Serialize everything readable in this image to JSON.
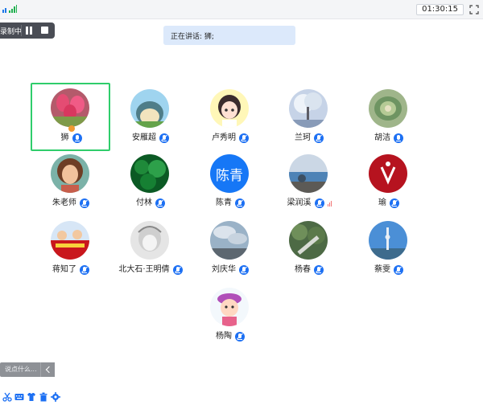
{
  "topbar": {
    "timer": "01:30:15",
    "icons": [
      "network-icon",
      "signal-icon",
      "fullscreen-icon"
    ]
  },
  "recording": {
    "label": "录制中",
    "pause": "pause-icon",
    "stop": "stop-icon"
  },
  "speaking": {
    "text": "正在讲话: 狮;"
  },
  "colors": {
    "accent": "#1d70f3",
    "active_border": "#2fcd6b",
    "speaking_bg": "#dce9fb"
  },
  "participants": [
    {
      "name": "狮",
      "mic": "active",
      "active": true,
      "owner": true,
      "avatar": "tulip-photo"
    },
    {
      "name": "安雁超",
      "mic": "muted",
      "avatar": "snorlax-cartoon"
    },
    {
      "name": "卢秀明",
      "mic": "muted",
      "avatar": "cartoon-girl"
    },
    {
      "name": "兰珂",
      "mic": "muted",
      "avatar": "tree-photo"
    },
    {
      "name": "胡洁",
      "mic": "active",
      "avatar": "succulent-photo"
    },
    {
      "name": "朱老师",
      "mic": "muted",
      "avatar": "cartoon-woman"
    },
    {
      "name": "付林",
      "mic": "muted",
      "avatar": "clover-photo"
    },
    {
      "name": "陈青",
      "mic": "muted",
      "avatar_text": "陈青"
    },
    {
      "name": "梁润溪",
      "mic": "muted",
      "signal": true,
      "avatar": "sea-photo"
    },
    {
      "name": "瑜",
      "mic": "muted",
      "avatar": "red-logo"
    },
    {
      "name": "蒋知了",
      "mic": "muted",
      "avatar": "festival-photo"
    },
    {
      "name": "北大石·王明倩",
      "mic": "muted",
      "avatar": "sketch-photo"
    },
    {
      "name": "刘庆华",
      "mic": "muted",
      "avatar": "sky-photo"
    },
    {
      "name": "杨春",
      "mic": "muted",
      "avatar": "forest-photo"
    },
    {
      "name": "蔡雯",
      "mic": "muted",
      "avatar": "tower-photo"
    },
    {
      "name": "杨陶",
      "mic": "muted",
      "avatar": "cartoon-child"
    }
  ],
  "chat": {
    "placeholder": "说点什么..."
  },
  "toolbar": {
    "icons": [
      "scissors-icon",
      "keyboard-icon",
      "shirt-icon",
      "trash-icon",
      "gear-icon"
    ]
  }
}
